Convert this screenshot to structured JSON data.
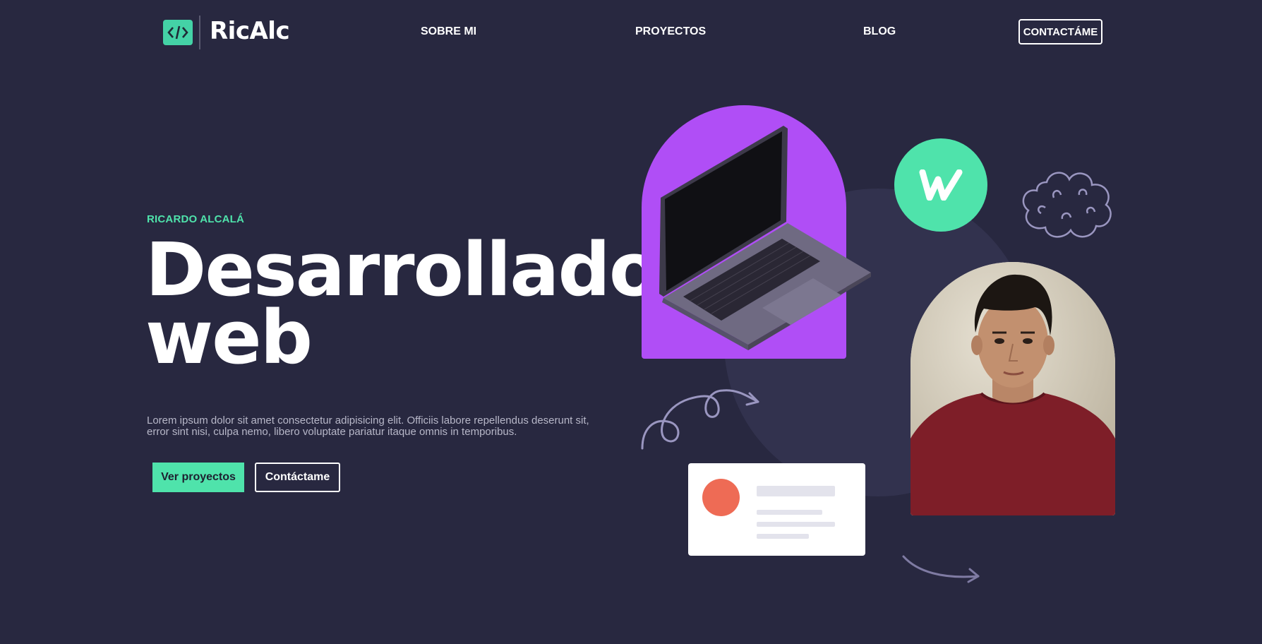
{
  "header": {
    "logo_text": "RicAlc",
    "nav": [
      {
        "label": "SOBRE MI"
      },
      {
        "label": "PROYECTOS"
      },
      {
        "label": "BLOG"
      }
    ],
    "cta_label": "CONTACTÁME"
  },
  "hero": {
    "eyebrow": "RICARDO ALCALÁ",
    "title_line1": "Desarrollador",
    "title_line2": "web",
    "description": "Lorem ipsum dolor sit amet consectetur adipisicing elit. Officiis labore repellendus deserunt sit, error sint nisi, culpa nemo, libero voluptate pariatur itaque omnis in temporibus.",
    "primary_button": "Ver proyectos",
    "secondary_button": "Contáctame"
  },
  "illustration": {
    "icons": [
      "code-icon",
      "laptop-image",
      "webflow-icon",
      "cloud-doodle-icon",
      "swirl-doodle-icon",
      "arrow-doodle-icon",
      "profile-card",
      "portrait-photo"
    ]
  },
  "colors": {
    "background": "#282840",
    "accent_green": "#4fe3ab",
    "accent_purple": "#b04ef6",
    "card_dot": "#ee6b55",
    "bg_circle": "#32324e"
  }
}
